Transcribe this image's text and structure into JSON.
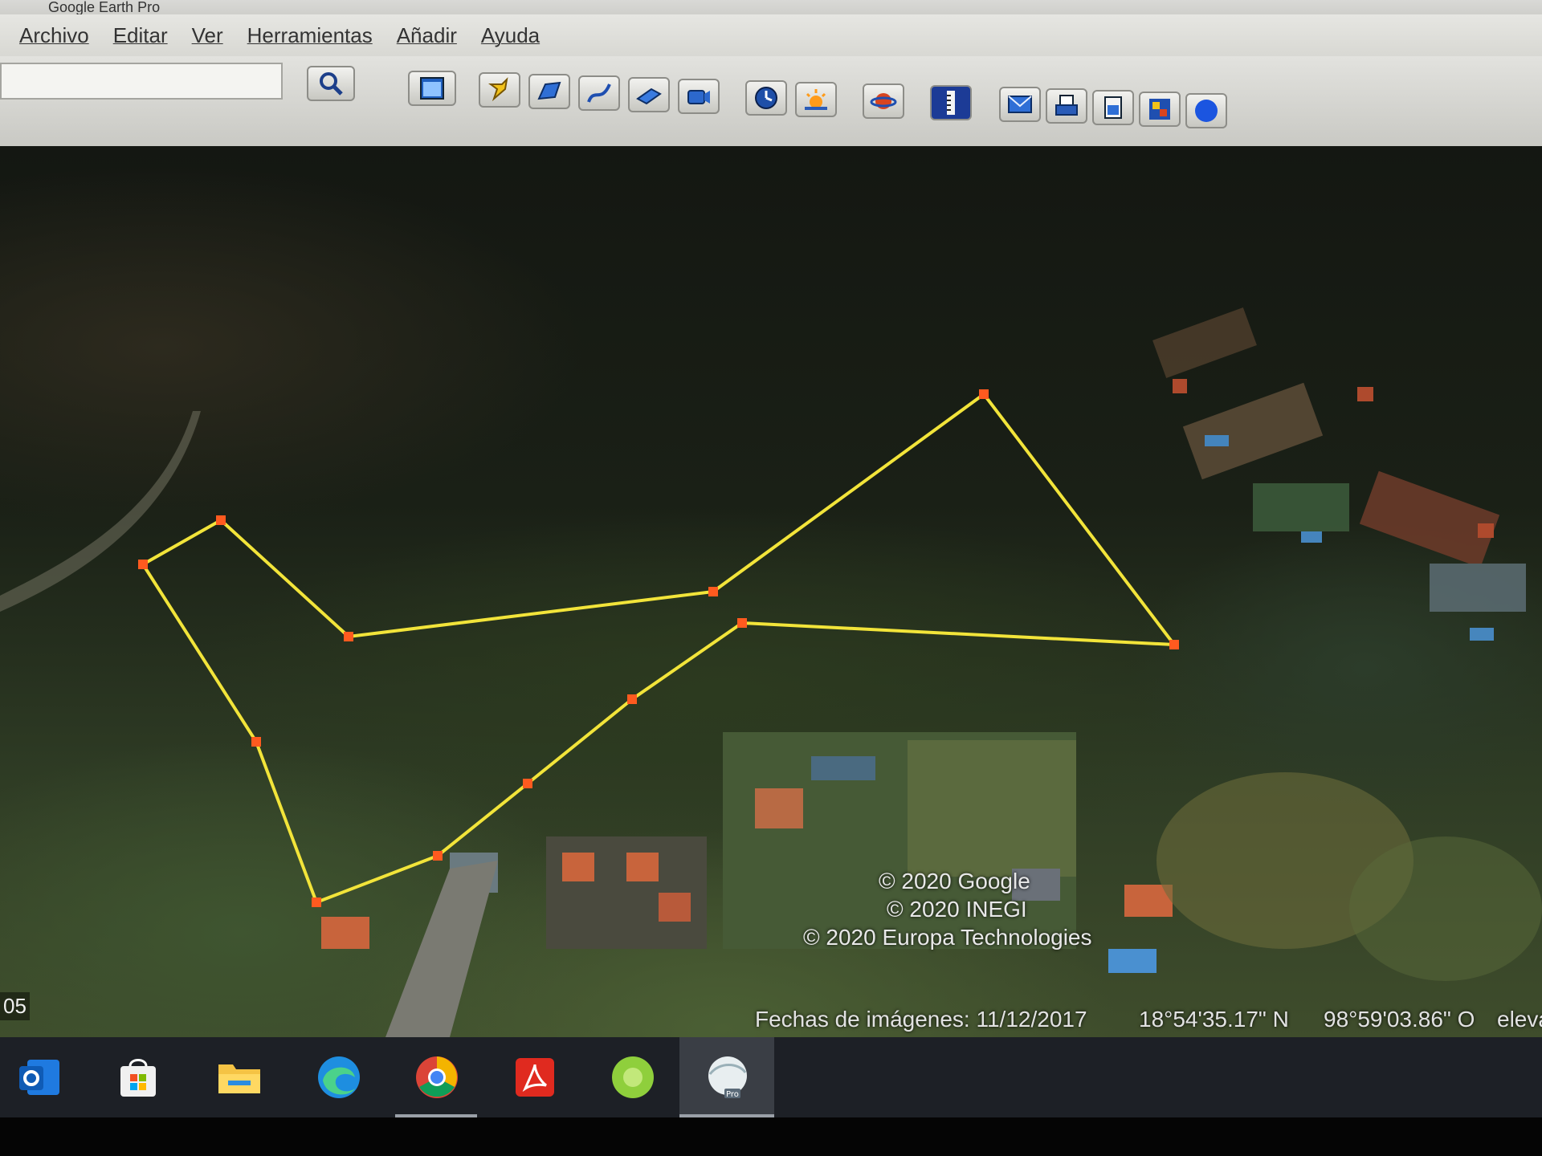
{
  "window": {
    "title": "Google Earth Pro"
  },
  "menu": {
    "items": [
      {
        "label": "Archivo"
      },
      {
        "label": "Editar"
      },
      {
        "label": "Ver"
      },
      {
        "label": "Herramientas"
      },
      {
        "label": "Añadir"
      },
      {
        "label": "Ayuda"
      }
    ]
  },
  "toolbar": {
    "search_value": "",
    "buttons": [
      "search-icon",
      "sidebar-icon",
      "placemark-icon",
      "polygon-icon",
      "path-icon",
      "image-overlay-icon",
      "record-tour-icon",
      "historical-imagery-icon",
      "sunlight-icon",
      "planets-icon",
      "ruler-icon",
      "email-icon",
      "print-icon",
      "save-image-icon",
      "maps-icon",
      "globe-icon"
    ]
  },
  "map": {
    "copyright": [
      "© 2020 Google",
      "© 2020 INEGI",
      "© 2020 Europa Technologies"
    ],
    "imagery_date_label": "Fechas de imágenes: 11/12/2017",
    "latitude": "18°54'35.17\" N",
    "longitude": "98°59'03.86\" O",
    "elevation_label": "eleva",
    "scale_fragment": "05",
    "path_color": "#f2e43a",
    "vertex_color": "#ff5a1f"
  },
  "taskbar": {
    "icons": [
      "outlook-icon",
      "store-icon",
      "file-explorer-icon",
      "edge-icon",
      "chrome-icon",
      "acrobat-icon",
      "green-app-icon",
      "google-earth-pro-icon"
    ],
    "pro_badge": "Pro"
  }
}
